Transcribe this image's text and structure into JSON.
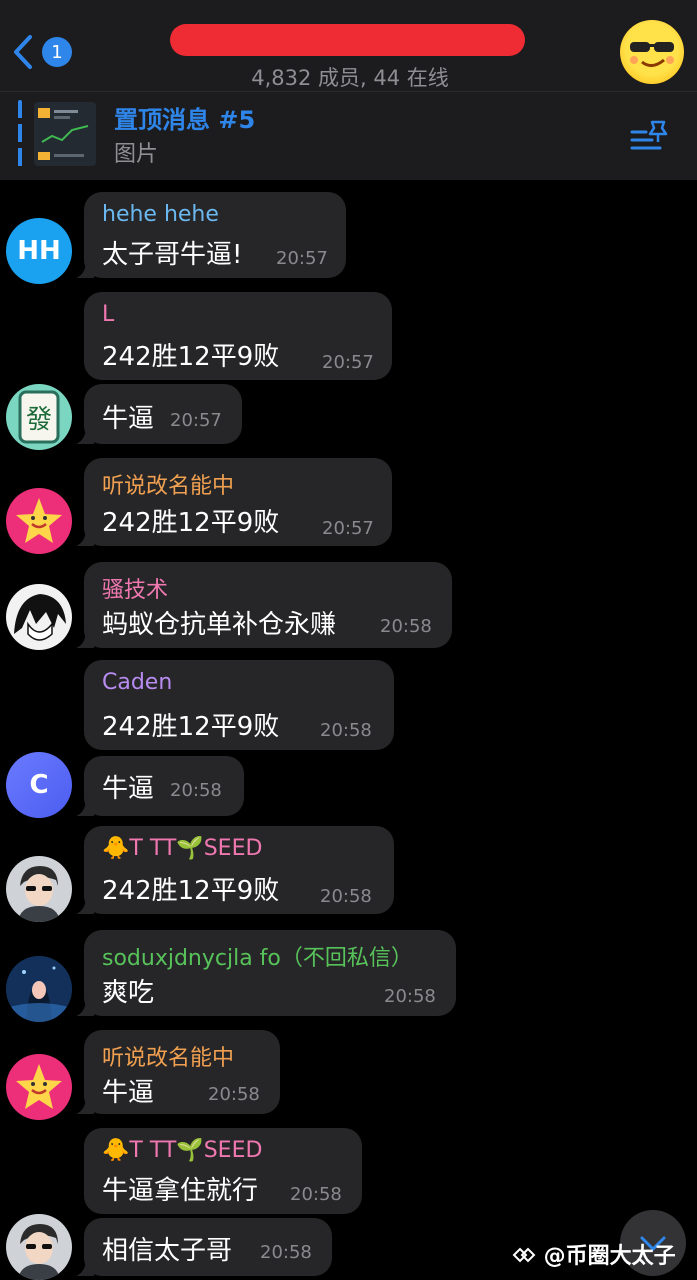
{
  "header": {
    "back_badge": "1",
    "group_title": "██████████",
    "subtitle": "4,832 成员, 44 在线"
  },
  "pinned": {
    "title": "置顶消息 #5",
    "subtitle": "图片"
  },
  "colors": {
    "accent": "#2f86ea",
    "bubble": "#262628",
    "redaction": "#ef2b34"
  },
  "messages": [
    {
      "sender": "hehe hehe",
      "sender_color": "#6bb8f0",
      "text": "太子哥牛逼!",
      "time": "20:57",
      "avatar": "HH"
    },
    {
      "sender": "L",
      "sender_color": "#f078b0",
      "text": "242胜12平9败",
      "time": "20:57"
    },
    {
      "sender": "",
      "text": "牛逼",
      "time": "20:57",
      "avatar_icon": "mahjong-fa-tile-icon"
    },
    {
      "sender": "听说改名能中",
      "sender_color": "#f0a050",
      "text": "242胜12平9败",
      "time": "20:57",
      "avatar_icon": "smiling-star-icon"
    },
    {
      "sender": "骚技术",
      "sender_color": "#f078b0",
      "text": "蚂蚁仓抗单补仓永赚",
      "time": "20:58",
      "avatar_icon": "anime-character-icon"
    },
    {
      "sender": "Caden",
      "sender_color": "#b88cf0",
      "text": "242胜12平9败",
      "time": "20:58"
    },
    {
      "sender": "",
      "text": "牛逼",
      "time": "20:58",
      "avatar": "C"
    },
    {
      "sender": "🐥T TT🌱SEED",
      "sender_color": "#f078b0",
      "text": "242胜12平9败",
      "time": "20:58",
      "avatar_icon": "anime-boy-icon"
    },
    {
      "sender": "soduxjdnycjla fo（不回私信）",
      "sender_color": "#58c25a",
      "text": "爽吃",
      "time": "20:58",
      "avatar_icon": "night-scene-girl-icon"
    },
    {
      "sender": "听说改名能中",
      "sender_color": "#f0a050",
      "text": "牛逼",
      "time": "20:58",
      "avatar_icon": "smiling-star-icon"
    },
    {
      "sender": "🐥T TT🌱SEED",
      "sender_color": "#f078b0",
      "text": "牛逼拿住就行",
      "time": "20:58"
    },
    {
      "sender": "",
      "text": "相信太子哥",
      "time": "20:58",
      "avatar_icon": "anime-boy-icon"
    }
  ],
  "watermark": "@币圈大太子"
}
